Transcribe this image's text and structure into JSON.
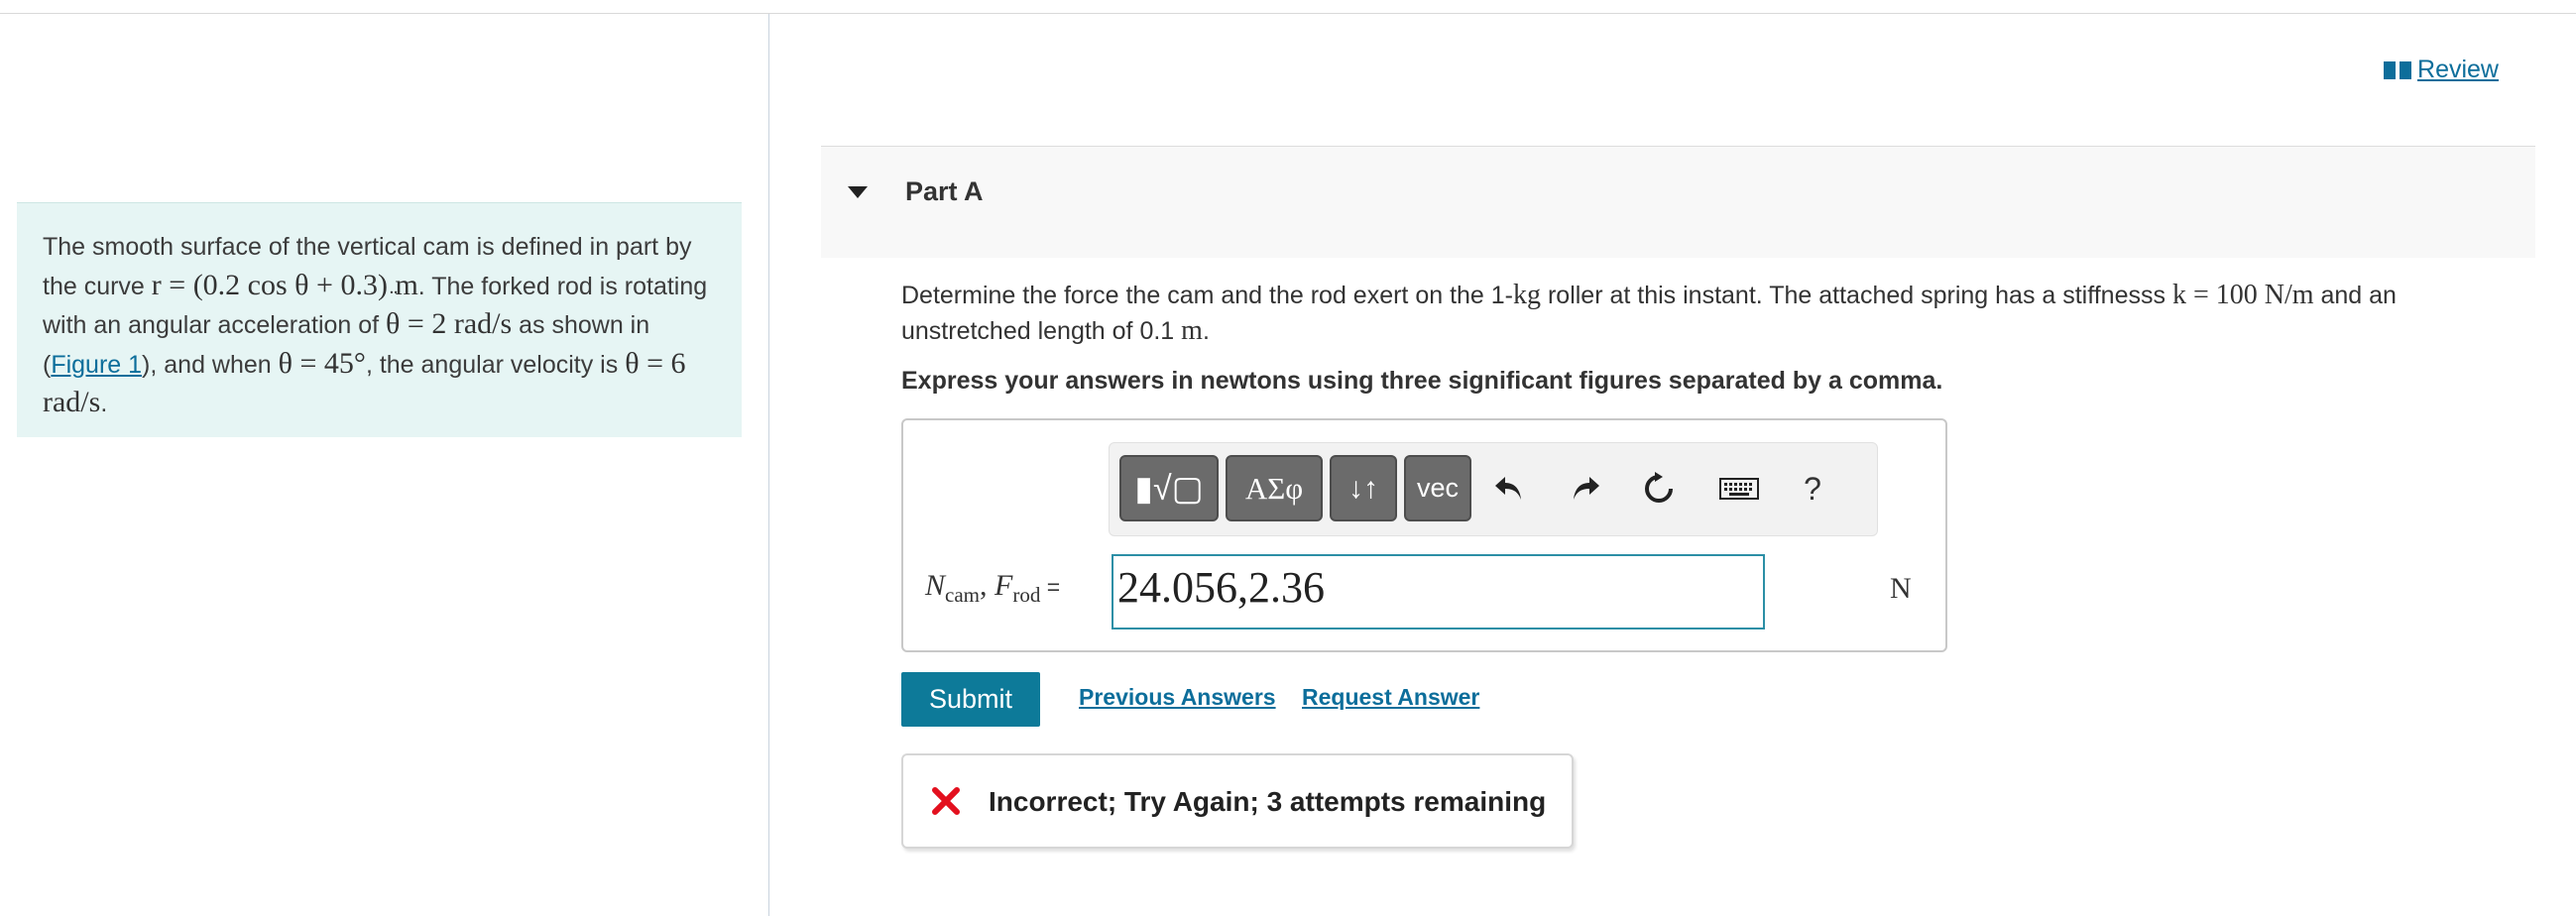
{
  "navigation": {
    "review_label": "Review"
  },
  "problem": {
    "text_1": "The smooth surface of the vertical cam is defined in part by the curve ",
    "math_1": "r = (0.2 cos θ + 0.3) m",
    "text_2": ". The forked rod is rotating with an angular acceleration of ",
    "math_2_sym": "θ",
    "math_2_dots": "¨",
    "math_2_rest": " = 2 rad/s",
    "text_3": " as shown in (",
    "figure_link": "Figure 1",
    "text_4": "), and when ",
    "math_3": "θ = 45°",
    "text_5": ", the angular velocity is ",
    "math_4_sym": "θ",
    "math_4_dot": "˙",
    "math_4_rest": " = 6 rad/s",
    "text_6": "."
  },
  "part": {
    "title": "Part A",
    "question_1": "Determine the force the cam and the rod exert on the 1-",
    "question_m1": "kg",
    "question_2": " roller at this instant. The attached spring has a stiffnesss ",
    "question_m2": "k = 100 N/m",
    "question_3": " and an unstretched length of 0.1 ",
    "question_m3": "m",
    "question_4": ".",
    "instruction": "Express your answers in newtons using three significant figures separated by a comma."
  },
  "toolbar": {
    "templates_label": "▮√▢",
    "greek_label": "ΑΣφ",
    "arrows_label": "↓↑",
    "vec_label": "vec",
    "help_label": "?"
  },
  "answer": {
    "label_n": "N",
    "label_n_sub": "cam",
    "label_sep": ", ",
    "label_f": "F",
    "label_f_sub": "rod",
    "equals": " =",
    "value": "24.056,2.36",
    "unit": "N"
  },
  "actions": {
    "submit_label": "Submit",
    "previous_label": "Previous Answers",
    "request_label": "Request Answer"
  },
  "feedback": {
    "message": "Incorrect; Try Again; 3 attempts remaining",
    "status_color": "#e3101e"
  }
}
